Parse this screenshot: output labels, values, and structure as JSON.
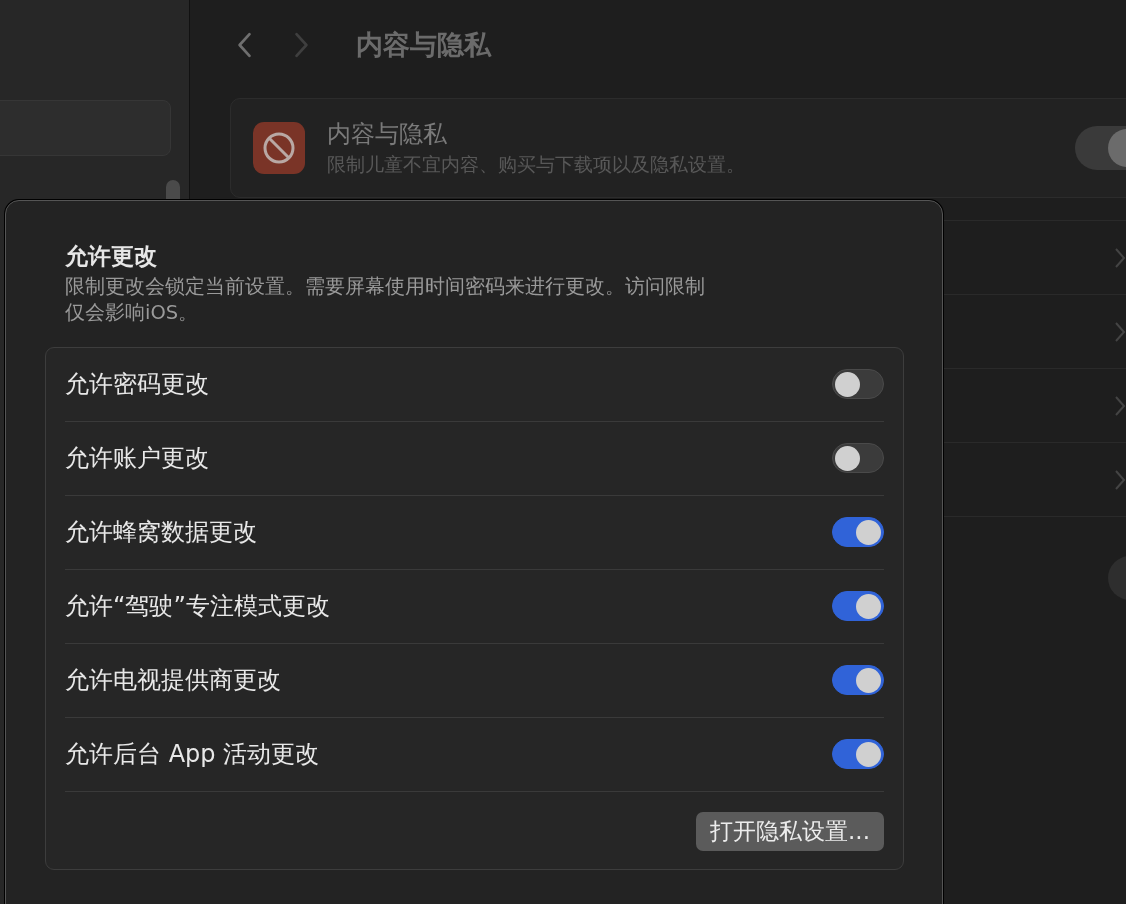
{
  "header": {
    "title": "内容与隐私"
  },
  "content_privacy": {
    "title": "内容与隐私",
    "subtitle": "限制儿童不宜内容、购买与下载项以及隐私设置。",
    "on": true
  },
  "sheet": {
    "title": "允许更改",
    "description": "限制更改会锁定当前设置。需要屏幕使用时间密码来进行更改。访问限制仅会影响iOS。",
    "options": [
      {
        "label": "允许密码更改",
        "on": false
      },
      {
        "label": "允许账户更改",
        "on": false
      },
      {
        "label": "允许蜂窝数据更改",
        "on": true
      },
      {
        "label": "允许“驾驶”专注模式更改",
        "on": true
      },
      {
        "label": "允许电视提供商更改",
        "on": true
      },
      {
        "label": "允许后台 App 活动更改",
        "on": true
      }
    ],
    "button": "打开隐私设置..."
  }
}
